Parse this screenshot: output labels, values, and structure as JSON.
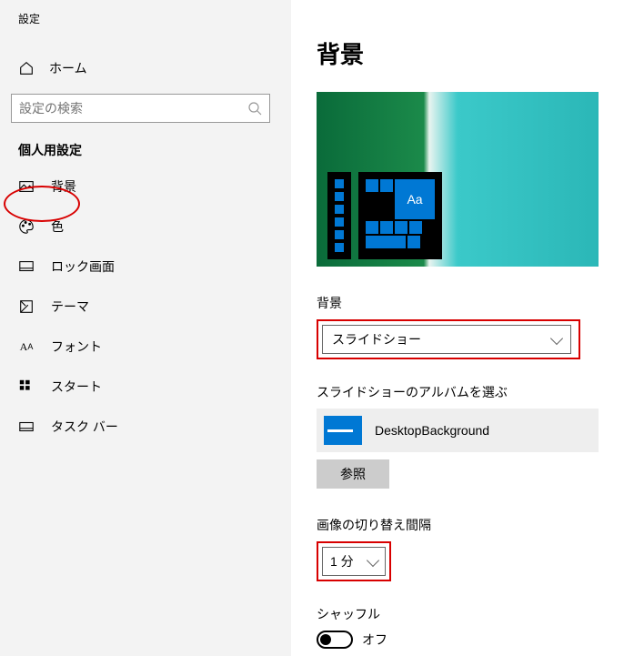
{
  "sidebar": {
    "title": "設定",
    "home_label": "ホーム",
    "search_placeholder": "設定の検索",
    "section_label": "個人用設定",
    "items": [
      {
        "label": "背景"
      },
      {
        "label": "色"
      },
      {
        "label": "ロック画面"
      },
      {
        "label": "テーマ"
      },
      {
        "label": "フォント"
      },
      {
        "label": "スタート"
      },
      {
        "label": "タスク バー"
      }
    ]
  },
  "content": {
    "page_title": "背景",
    "preview_tile_text": "Aa",
    "bg_label": "背景",
    "bg_value": "スライドショー",
    "album_label": "スライドショーのアルバムを選ぶ",
    "album_name": "DesktopBackground",
    "browse_label": "参照",
    "interval_label": "画像の切り替え間隔",
    "interval_value": "1 分",
    "shuffle_label": "シャッフル",
    "shuffle_state_label": "オフ"
  }
}
